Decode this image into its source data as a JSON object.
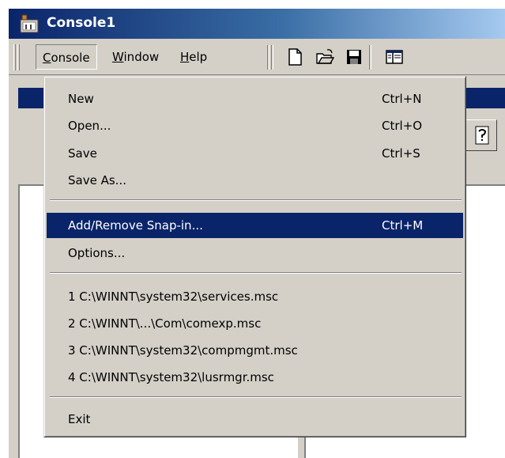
{
  "window": {
    "title": "Console1",
    "title_icon": "mmc-console-icon"
  },
  "menubar": {
    "items": [
      {
        "label": "Console",
        "mnemonic": "C"
      },
      {
        "label": "Window",
        "mnemonic": "W"
      },
      {
        "label": "Help",
        "mnemonic": "H"
      }
    ],
    "toolbar_icons": [
      "new-document-icon",
      "open-folder-icon",
      "save-disk-icon",
      "show-hide-console-tree-icon"
    ]
  },
  "console_menu": {
    "groups": [
      [
        {
          "label": "New",
          "shortcut": "Ctrl+N"
        },
        {
          "label": "Open...",
          "shortcut": "Ctrl+O"
        },
        {
          "label": "Save",
          "shortcut": "Ctrl+S"
        },
        {
          "label": "Save As...",
          "shortcut": ""
        }
      ],
      [
        {
          "label": "Add/Remove Snap-in...",
          "shortcut": "Ctrl+M",
          "highlighted": true
        },
        {
          "label": "Options...",
          "shortcut": ""
        }
      ],
      [
        {
          "label": "1 C:\\WINNT\\system32\\services.msc"
        },
        {
          "label": "2 C:\\WINNT\\...\\Com\\comexp.msc"
        },
        {
          "label": "3 C:\\WINNT\\system32\\compmgmt.msc"
        },
        {
          "label": "4 C:\\WINNT\\system32\\lusrmgr.msc"
        }
      ],
      [
        {
          "label": "Exit"
        }
      ]
    ]
  },
  "colors": {
    "face": "#d4d0c8",
    "titlebar_start": "#0a246a",
    "titlebar_end": "#a6caf0",
    "highlight": "#0a246a",
    "highlight_text": "#ffffff"
  }
}
